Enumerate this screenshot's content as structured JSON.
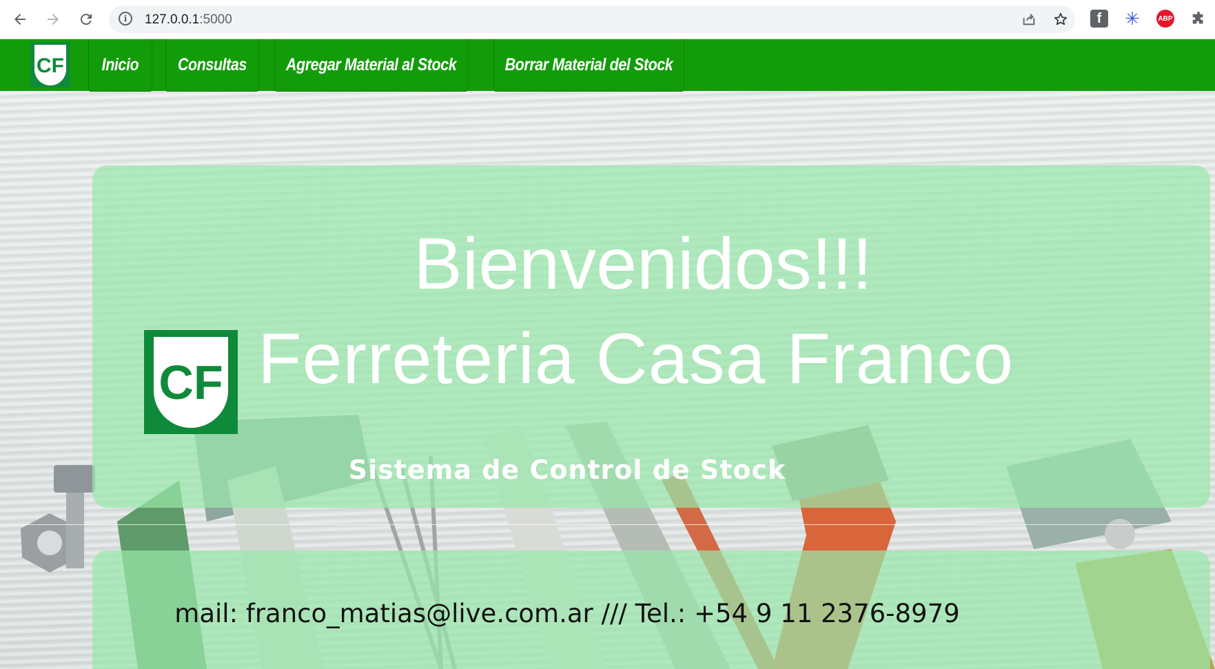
{
  "browser": {
    "url_host": "127.0.0.1",
    "url_port": ":5000",
    "icons": {
      "back": "arrow-left-icon",
      "forward": "arrow-right-icon",
      "reload": "reload-icon",
      "info": "info-icon",
      "share": "share-icon",
      "bookmark": "star-icon",
      "extensions": [
        "facebook-icon",
        "snowflake-icon",
        "adblock-icon",
        "puzzle-icon"
      ]
    },
    "abp_label": "ABP",
    "fb_label": "f"
  },
  "navbar": {
    "color": "#139c0a",
    "logo_alt": "CF",
    "items": [
      {
        "label": "Inicio"
      },
      {
        "label": "Consultas"
      },
      {
        "label": "Agregar Material al Stock"
      },
      {
        "label": "Borrar Material del Stock"
      }
    ]
  },
  "hero": {
    "title": "Bienvenidos!!!",
    "name": "Ferreteria Casa Franco",
    "subtitle": "Sistema de Control de Stock",
    "logo_text": "CF"
  },
  "footer": {
    "contact": "mail: franco_matias@live.com.ar /// Tel.: +54 9 11 2376-8979"
  },
  "colors": {
    "brand_green": "#139c0a",
    "panel_green": "#98e8aa",
    "logo_green": "#0f8a3a"
  }
}
